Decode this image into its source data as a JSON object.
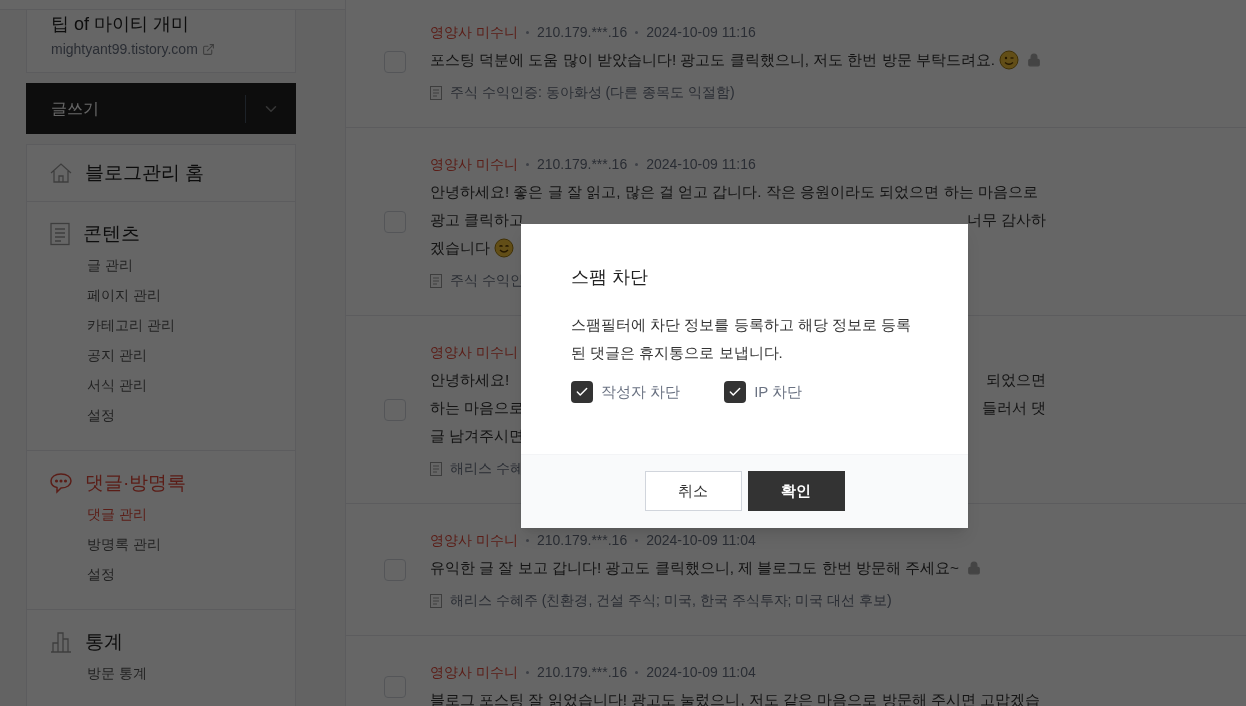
{
  "blog": {
    "title": "팁 of 마이티 개미",
    "url": "mightyant99.tistory.com"
  },
  "write_button": {
    "label": "글쓰기"
  },
  "nav": [
    {
      "kind": "home",
      "label": "블로그관리 홈",
      "selected": false
    },
    {
      "kind": "document",
      "label": "콘텐츠",
      "selected": false,
      "children": [
        {
          "label": "글 관리",
          "selected": false
        },
        {
          "label": "페이지 관리",
          "selected": false
        },
        {
          "label": "카테고리 관리",
          "selected": false
        },
        {
          "label": "공지 관리",
          "selected": false
        },
        {
          "label": "서식 관리",
          "selected": false
        },
        {
          "label": "설정",
          "selected": false
        }
      ]
    },
    {
      "kind": "chat",
      "label": "댓글·방명록",
      "selected": true,
      "children": [
        {
          "label": "댓글 관리",
          "selected": true
        },
        {
          "label": "방명록 관리",
          "selected": false
        },
        {
          "label": "설정",
          "selected": false
        }
      ]
    },
    {
      "kind": "chart",
      "label": "통계",
      "selected": false,
      "children": [
        {
          "label": "방문 통계",
          "selected": false
        }
      ]
    }
  ],
  "comments": [
    {
      "author": "영양사 미수니",
      "ip": "210.179.***.16",
      "date": "2024-10-09 11:16",
      "checked": false,
      "lines": [
        {
          "text": "포스팅 덕분에 도움 많이 받았습니다! 광고도 클릭했으니, 저도 한번 방문 부탁드려요."
        }
      ],
      "emoji": {
        "kind": "wink"
      },
      "locked": true,
      "post": "주식 수익인증: 동아화성 (다른 종목도 익절함)"
    },
    {
      "author": "영양사 미수니",
      "ip": "210.179.***.16",
      "date": "2024-10-09 11:16",
      "checked": false,
      "lines": [
        {
          "text": "안녕하세요! 좋은 글 잘 읽고, 많은 걸 얻고 갑니다. 작은 응원이라도 되었으면 하는 마음으로"
        },
        {
          "text": "광고 클릭하고",
          "text_right": "너무 감사하"
        },
        {
          "text": "겠습니다"
        }
      ],
      "emoji": {
        "kind": "smile"
      },
      "locked": false,
      "post": "주식 수익인"
    },
    {
      "author": "영양사 미수니",
      "checked": false,
      "lines": [
        {
          "text": "안녕하세요!",
          "text_right": "되었으면"
        },
        {
          "text": "하는 마음으로",
          "text_right": "들러서 댓"
        },
        {
          "text": "글 남겨주시면"
        }
      ],
      "locked": false,
      "post": "해리스 수혜"
    },
    {
      "author": "영양사 미수니",
      "ip": "210.179.***.16",
      "date": "2024-10-09 11:04",
      "checked": false,
      "lines": [
        {
          "text": "유익한 글 잘 보고 갑니다! 광고도 클릭했으니, 제 블로그도 한번 방문해 주세요~"
        }
      ],
      "locked": true,
      "post": "해리스 수혜주 (친환경, 건설 주식; 미국, 한국 주식투자; 미국 대선 후보)"
    },
    {
      "author": "영양사 미수니",
      "ip": "210.179.***.16",
      "date": "2024-10-09 11:04",
      "checked": false,
      "lines": [
        {
          "text": "블로그 포스팅 잘 읽었습니다! 광고도 눌렀으니, 저도 같은 마음으로 방문해 주시면 고맙겠습"
        }
      ],
      "locked": false
    }
  ],
  "modal": {
    "title": "스팸 차단",
    "message": "스팸필터에 차단 정보를 등록하고 해당 정보로 등록된 댓글은 휴지통으로 보냅니다.",
    "options": [
      {
        "label": "작성자 차단",
        "checked": true
      },
      {
        "label": "IP 차단",
        "checked": true
      }
    ],
    "buttons": [
      {
        "label": "취소",
        "kind": "secondary"
      },
      {
        "label": "확인",
        "kind": "primary"
      }
    ]
  }
}
